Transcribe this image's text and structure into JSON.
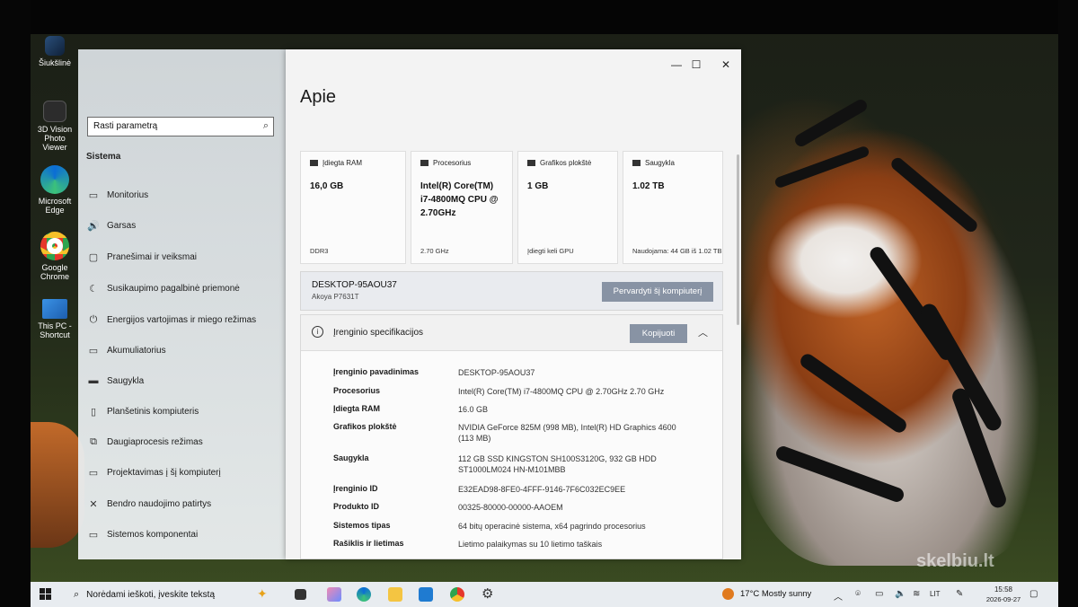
{
  "desktop_icons": [
    {
      "label": "Šiukšlinė",
      "icon": "recycle-bin-icon"
    },
    {
      "label": "3D Vision Photo Viewer",
      "icon": "photo-viewer-icon"
    },
    {
      "label": "Microsoft Edge",
      "icon": "edge-icon"
    },
    {
      "label": "Google Chrome",
      "icon": "chrome-icon"
    },
    {
      "label": "This PC - Shortcut",
      "icon": "this-pc-icon"
    }
  ],
  "settings": {
    "search_placeholder": "Rasti parametrą",
    "section_title": "Sistema",
    "nav_items": [
      {
        "label": "Monitorius",
        "icon": "▭"
      },
      {
        "label": "Garsas",
        "icon": "🔊"
      },
      {
        "label": "Pranešimai ir veiksmai",
        "icon": "▢"
      },
      {
        "label": "Susikaupimo pagalbinė priemonė",
        "icon": "☾"
      },
      {
        "label": "Energijos vartojimas ir miego režimas",
        "icon": "⏻"
      },
      {
        "label": "Akumuliatorius",
        "icon": "▭"
      },
      {
        "label": "Saugykla",
        "icon": "▬"
      },
      {
        "label": "Planšetinis kompiuteris",
        "icon": "▯"
      },
      {
        "label": "Daugiaprocesis režimas",
        "icon": "⧉"
      },
      {
        "label": "Projektavimas į šį kompiuterį",
        "icon": "▭"
      },
      {
        "label": "Bendro naudojimo patirtys",
        "icon": "✕"
      },
      {
        "label": "Sistemos komponentai",
        "icon": "▭"
      }
    ]
  },
  "about": {
    "title": "Apie",
    "window_controls": {
      "minimize": "—",
      "maximize": "☐",
      "close": "✕"
    },
    "cards": [
      {
        "label": "Įdiegta RAM",
        "value": "16,0 GB",
        "sub": "DDR3"
      },
      {
        "label": "Procesorius",
        "value": "Intel(R) Core(TM) i7-4800MQ CPU @ 2.70GHz",
        "sub": "2.70 GHz"
      },
      {
        "label": "Grafikos plokštė",
        "value": "1 GB",
        "sub": "Įdiegti keli GPU"
      },
      {
        "label": "Saugykla",
        "value": "1.02 TB",
        "sub": "Naudojama: 44 GB iš 1.02 TB"
      }
    ],
    "device": {
      "name": "DESKTOP-95AOU37",
      "model": "Akoya P7631T",
      "rename_label": "Pervardyti šį kompiuterį"
    },
    "specs": {
      "title": "Įrenginio specifikacijos",
      "copy_label": "Kopijuoti",
      "rows": [
        {
          "key": "Įrenginio pavadinimas",
          "value": "DESKTOP-95AOU37"
        },
        {
          "key": "Procesorius",
          "value": "Intel(R) Core(TM) i7-4800MQ CPU @ 2.70GHz   2.70 GHz"
        },
        {
          "key": "Įdiegta RAM",
          "value": "16.0 GB"
        },
        {
          "key": "Grafikos plokštė",
          "value": "NVIDIA GeForce 825M (998 MB), Intel(R) HD Graphics 4600 (113 MB)"
        },
        {
          "key": "Saugykla",
          "value": "112 GB SSD KINGSTON SH100S3120G, 932 GB HDD ST1000LM024 HN-M101MBB"
        },
        {
          "key": "Įrenginio ID",
          "value": "E32EAD98-8FE0-4FFF-9146-7F6C032EC9EE"
        },
        {
          "key": "Produkto ID",
          "value": "00325-80000-00000-AAOEM"
        },
        {
          "key": "Sistemos tipas",
          "value": "64 bitų operacinė sistema, x64 pagrindo procesorius"
        },
        {
          "key": "Rašiklis ir lietimas",
          "value": "Lietimo palaikymas su 10 lietimo taškais"
        }
      ]
    }
  },
  "taskbar": {
    "search_text": "Norėdami ieškoti, įveskite tekstą",
    "weather": "17°C  Mostly sunny",
    "language": "LIT",
    "time": "15:58",
    "date": "2026-09-27"
  },
  "watermark": "skelbiu.lt"
}
